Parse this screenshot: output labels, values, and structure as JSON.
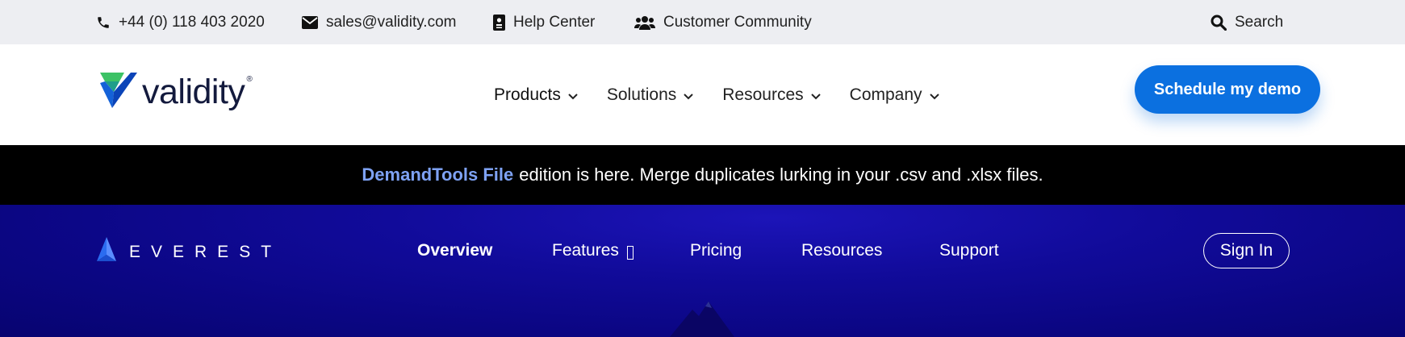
{
  "utility_bar": {
    "phone": "+44 (0) 118 403 2020",
    "email": "sales@validity.com",
    "help": "Help Center",
    "community": "Customer Community",
    "search": "Search"
  },
  "header": {
    "logo_text": "validity",
    "logo_reg": "®",
    "nav": [
      "Products",
      "Solutions",
      "Resources",
      "Company"
    ],
    "demo_button": "Schedule my demo"
  },
  "announcement": {
    "highlight": "DemandTools File",
    "text": "edition is here. Merge duplicates lurking in your .csv and .xlsx files."
  },
  "everest_nav": {
    "logo_text": "EVEREST",
    "links": [
      "Overview",
      "Features",
      "Pricing",
      "Resources",
      "Support"
    ],
    "active": "Overview",
    "sign_in": "Sign In"
  },
  "colors": {
    "utility_bg": "#edeef2",
    "brand_blue": "#0b70e0",
    "highlight_blue": "#7ea2f4",
    "everest_bg": "#0b0683",
    "logo_green": "#3cc265",
    "logo_dark": "#131a3d"
  },
  "icons": [
    "phone-icon",
    "mail-icon",
    "help-book-icon",
    "users-icon",
    "search-icon",
    "chevron-down-icon",
    "everest-logo-icon"
  ]
}
